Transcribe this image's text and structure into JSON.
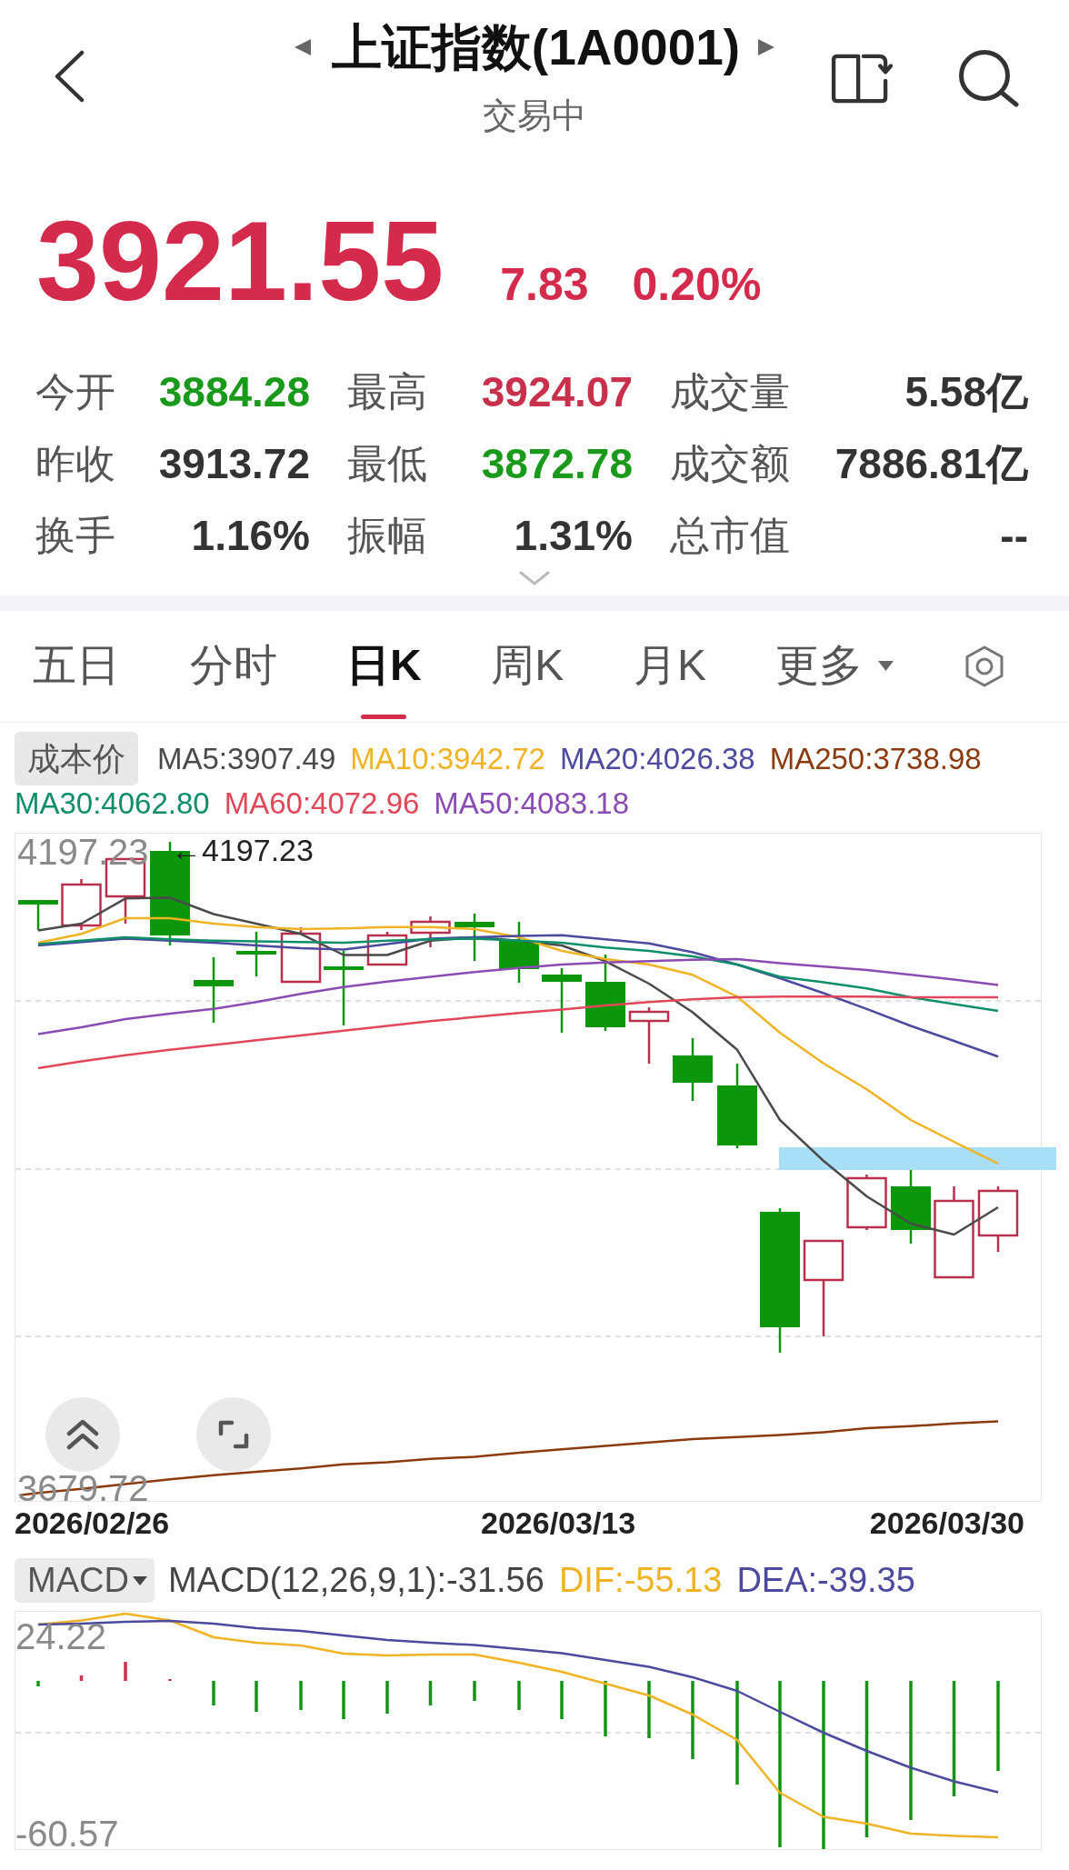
{
  "header": {
    "title": "上证指数(1A0001)",
    "status": "交易中"
  },
  "quote": {
    "price": "3921.55",
    "change": "7.83",
    "change_percent": "0.20%",
    "color": "#d42a4b"
  },
  "stats": [
    {
      "label": "今开",
      "value": "3884.28",
      "color": "#1a9a1a"
    },
    {
      "label": "最高",
      "value": "3924.07",
      "color": "#c9304b"
    },
    {
      "label": "成交量",
      "value": "5.58亿",
      "color": "#333333"
    },
    {
      "label": "昨收",
      "value": "3913.72",
      "color": "#333333"
    },
    {
      "label": "最低",
      "value": "3872.78",
      "color": "#1a9a1a"
    },
    {
      "label": "成交额",
      "value": "7886.81亿",
      "color": "#333333"
    },
    {
      "label": "换手",
      "value": "1.16%",
      "color": "#333333"
    },
    {
      "label": "振幅",
      "value": "1.31%",
      "color": "#333333"
    },
    {
      "label": "总市值",
      "value": "--",
      "color": "#333333"
    }
  ],
  "period_tabs": [
    {
      "label": "五日",
      "selected": false,
      "kind": "tab"
    },
    {
      "label": "分时",
      "selected": false,
      "kind": "tab"
    },
    {
      "label": "日K",
      "selected": true,
      "kind": "tab"
    },
    {
      "label": "周K",
      "selected": false,
      "kind": "tab"
    },
    {
      "label": "月K",
      "selected": false,
      "kind": "tab"
    },
    {
      "label": "更多",
      "selected": false,
      "kind": "menu"
    }
  ],
  "indicator_bar": {
    "cost_button": "成本价",
    "moving_averages": [
      {
        "label": "MA5:3907.49",
        "color": "#4a4a4a"
      },
      {
        "label": "MA10:3942.72",
        "color": "#f0b323"
      },
      {
        "label": "MA20:4026.38",
        "color": "#4b4a9e"
      },
      {
        "label": "MA250:3738.98",
        "color": "#8b3a0e"
      },
      {
        "label": "MA30:4062.80",
        "color": "#0e8f6a"
      },
      {
        "label": "MA60:4072.96",
        "color": "#e0485a"
      },
      {
        "label": "MA50:4083.18",
        "color": "#8a4cb2"
      }
    ]
  },
  "kline_chart": {
    "top_label": "4197.23",
    "high_marker": "←4197.23",
    "bottom_label": "3679.72",
    "dates": [
      "2026/02/26",
      "2026/03/13",
      "2026/03/30"
    ]
  },
  "macd_panel": {
    "selector": "MACD",
    "legend": [
      {
        "label": "MACD(12,26,9,1):-31.56",
        "color": "#444444"
      },
      {
        "label": "DIF:-55.13",
        "color": "#f0b323"
      },
      {
        "label": "DEA:-39.35",
        "color": "#4b4a9e"
      }
    ],
    "top_label": "24.22",
    "bottom_label": "-60.57"
  }
}
